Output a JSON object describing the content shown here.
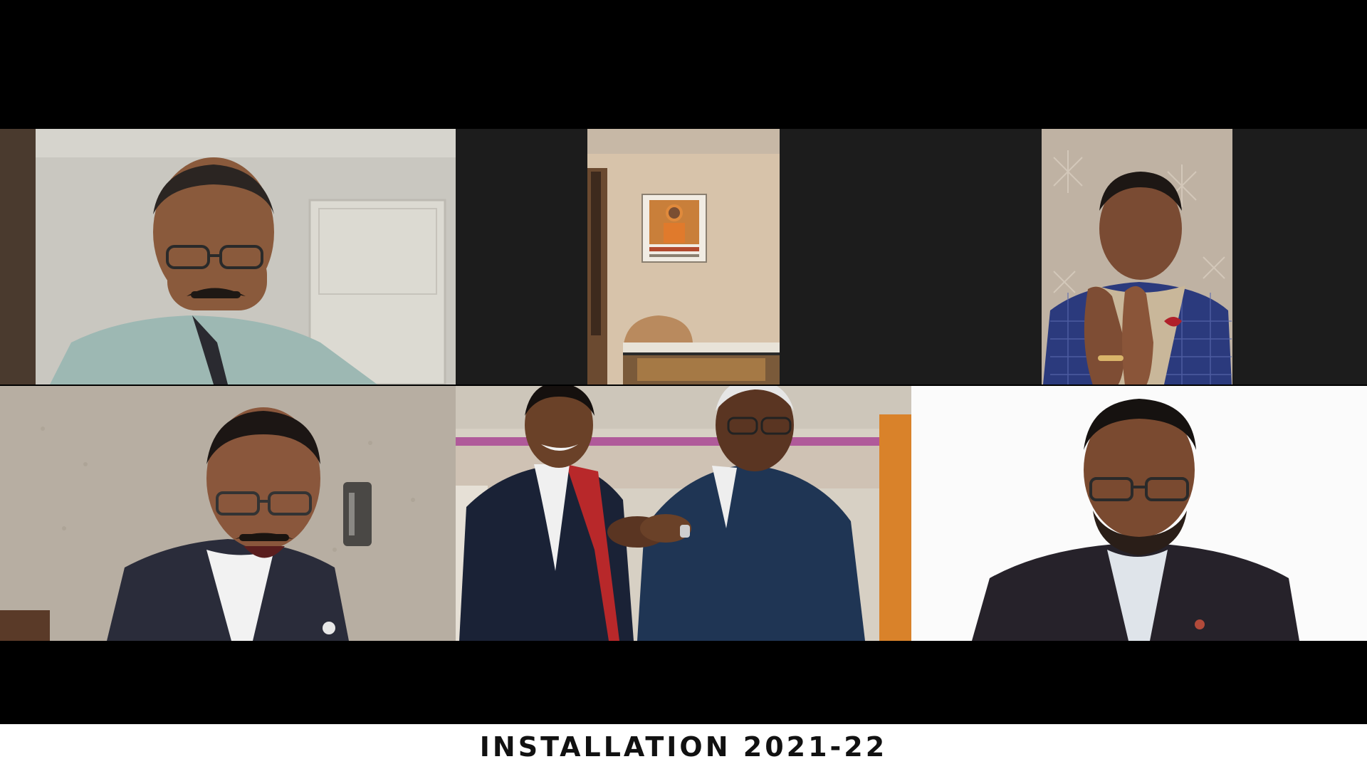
{
  "meeting": {
    "layout": "gallery-view",
    "participant_tiles": [
      {
        "tile": "participant-1",
        "scene": "man-glasses-mustache-light-room"
      },
      {
        "tile": "participant-2",
        "scene": "empty-room-with-wall-calendar"
      },
      {
        "tile": "participant-3",
        "scene": "man-clapping-blue-checked-kurta"
      },
      {
        "tile": "participant-4",
        "scene": "man-laughing-dark-suit"
      },
      {
        "tile": "participant-5",
        "scene": "two-men-collar-pinning"
      },
      {
        "tile": "participant-6",
        "scene": "young-man-glasses-white-background"
      }
    ]
  },
  "caption": {
    "text": "INSTALLATION 2021-22"
  },
  "colors": {
    "letterbox": "#000000",
    "caption_bar": "#ffffff",
    "caption_text": "#111111",
    "tile_gap": "#000000"
  }
}
